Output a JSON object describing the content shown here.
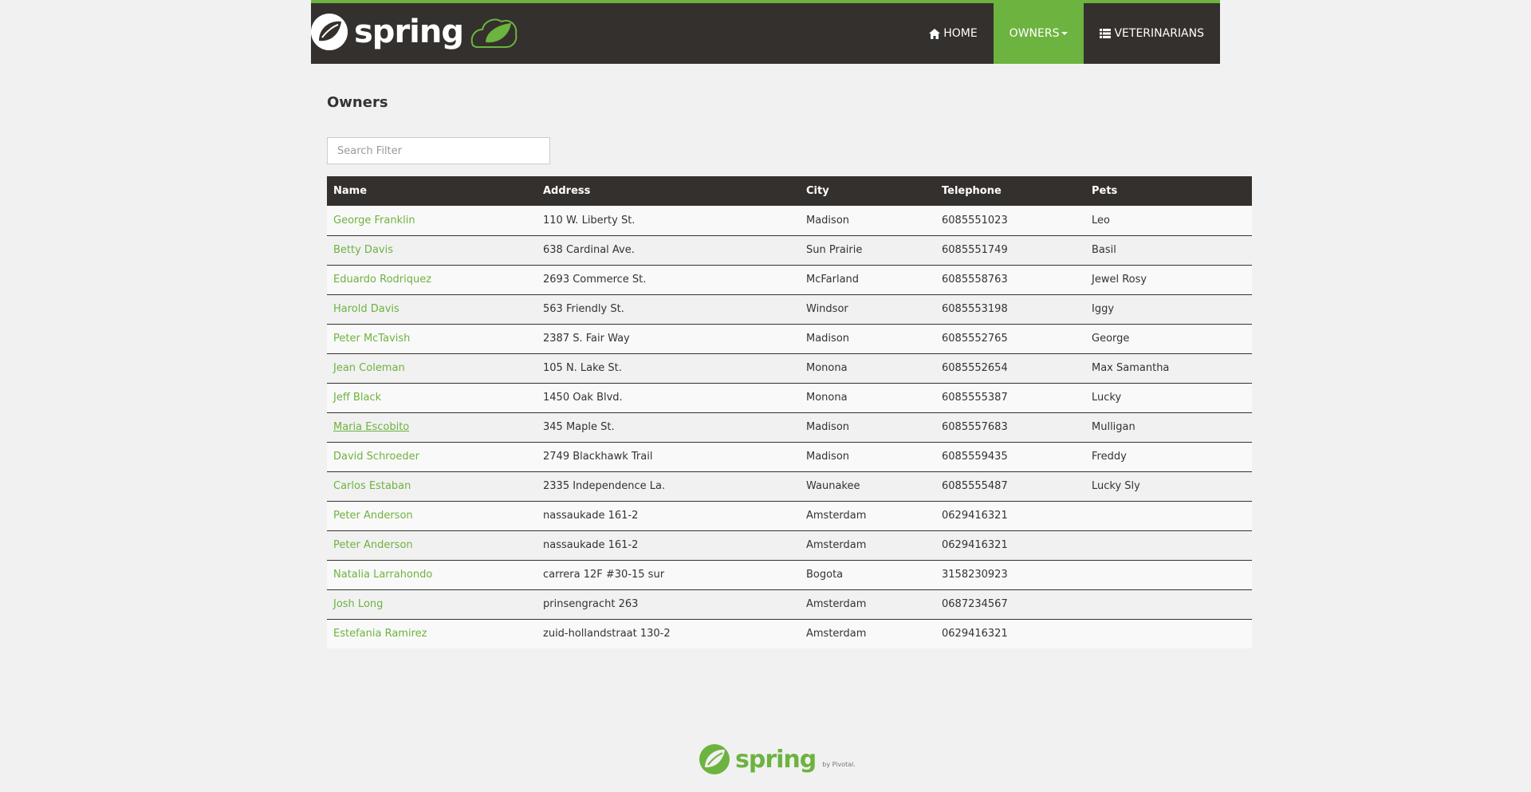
{
  "header": {
    "brand": "spring",
    "nav": [
      {
        "label": "HOME",
        "icon": "home-icon"
      },
      {
        "label": "OWNERS",
        "icon": "",
        "active": true
      },
      {
        "label": "VETERINARIANS",
        "icon": "list-icon"
      }
    ]
  },
  "main": {
    "title": "Owners",
    "search_placeholder": "Search Filter",
    "columns": [
      "Name",
      "Address",
      "City",
      "Telephone",
      "Pets"
    ],
    "rows": [
      {
        "name": "George Franklin",
        "address": "110 W. Liberty St.",
        "city": "Madison",
        "telephone": "6085551023",
        "pets": "Leo"
      },
      {
        "name": "Betty Davis",
        "address": "638 Cardinal Ave.",
        "city": "Sun Prairie",
        "telephone": "6085551749",
        "pets": "Basil"
      },
      {
        "name": "Eduardo Rodriquez",
        "address": "2693 Commerce St.",
        "city": "McFarland",
        "telephone": "6085558763",
        "pets": "Jewel Rosy"
      },
      {
        "name": "Harold Davis",
        "address": "563 Friendly St.",
        "city": "Windsor",
        "telephone": "6085553198",
        "pets": "Iggy"
      },
      {
        "name": "Peter McTavish",
        "address": "2387 S. Fair Way",
        "city": "Madison",
        "telephone": "6085552765",
        "pets": "George"
      },
      {
        "name": "Jean Coleman",
        "address": "105 N. Lake St.",
        "city": "Monona",
        "telephone": "6085552654",
        "pets": "Max Samantha"
      },
      {
        "name": "Jeff Black",
        "address": "1450 Oak Blvd.",
        "city": "Monona",
        "telephone": "6085555387",
        "pets": "Lucky"
      },
      {
        "name": "Maria Escobito",
        "address": "345 Maple St.",
        "city": "Madison",
        "telephone": "6085557683",
        "pets": "Mulligan",
        "hovered": true
      },
      {
        "name": "David Schroeder",
        "address": "2749 Blackhawk Trail",
        "city": "Madison",
        "telephone": "6085559435",
        "pets": "Freddy"
      },
      {
        "name": "Carlos Estaban",
        "address": "2335 Independence La.",
        "city": "Waunakee",
        "telephone": "6085555487",
        "pets": "Lucky Sly"
      },
      {
        "name": "Peter Anderson",
        "address": "nassaukade 161-2",
        "city": "Amsterdam",
        "telephone": "0629416321",
        "pets": ""
      },
      {
        "name": "Peter Anderson",
        "address": "nassaukade 161-2",
        "city": "Amsterdam",
        "telephone": "0629416321",
        "pets": ""
      },
      {
        "name": "Natalia Larrahondo",
        "address": "carrera 12F #30-15 sur",
        "city": "Bogota",
        "telephone": "3158230923",
        "pets": ""
      },
      {
        "name": "Josh Long",
        "address": "prinsengracht 263",
        "city": "Amsterdam",
        "telephone": "0687234567",
        "pets": ""
      },
      {
        "name": "Estefania Ramirez",
        "address": "zuid-hollandstraat 130-2",
        "city": "Amsterdam",
        "telephone": "0629416321",
        "pets": ""
      }
    ]
  },
  "footer": {
    "brand": "spring",
    "by": "by Pivotal."
  },
  "colors": {
    "accent": "#6db33f",
    "dark": "#34302d",
    "background": "#f1f1f1"
  }
}
